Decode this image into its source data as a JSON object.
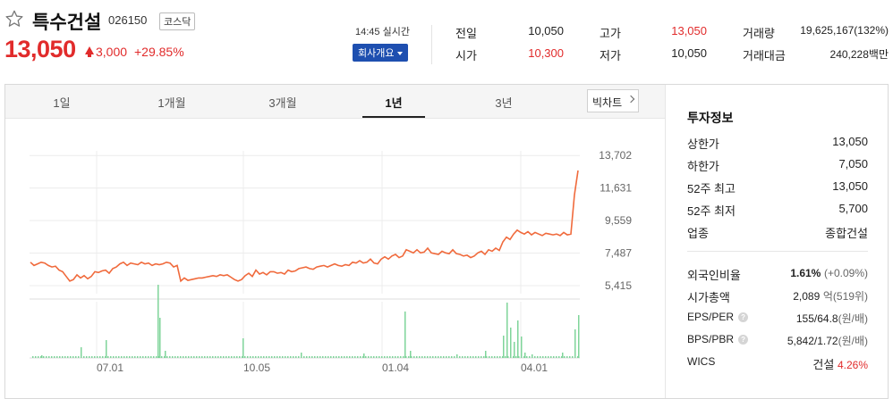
{
  "stock": {
    "name": "특수건설",
    "code": "026150",
    "market": "코스닥",
    "price": "13,050",
    "change": "3,000",
    "change_pct": "+29.85%",
    "realtime": "14:45 실시간",
    "company_button": "회사개요"
  },
  "quotes": {
    "prev_close_label": "전일",
    "prev_close": "10,050",
    "open_label": "시가",
    "open": "10,300",
    "high_label": "고가",
    "high": "13,050",
    "low_label": "저가",
    "low": "10,050",
    "volume_label": "거래량",
    "volume": "19,625,167(132%)",
    "amount_label": "거래대금",
    "amount": "240,228백만"
  },
  "tabs": [
    "1일",
    "1개월",
    "3개월",
    "1년",
    "3년"
  ],
  "active_tab": "1년",
  "big_chart_label": "빅차트",
  "investment": {
    "title": "투자정보",
    "rows": [
      {
        "label": "상한가",
        "value": "13,050"
      },
      {
        "label": "하한가",
        "value": "7,050"
      },
      {
        "label": "52주 최고",
        "value": "13,050"
      },
      {
        "label": "52주 최저",
        "value": "5,700"
      },
      {
        "label": "업종",
        "value": "종합건설"
      }
    ],
    "rows2": [
      {
        "label": "외국인비율",
        "value": "1.61%",
        "extra": "(+0.09%)"
      },
      {
        "label": "시가총액",
        "value": "2,089",
        "extra": "억(519위)"
      },
      {
        "label": "EPS/PER",
        "value": "155/64.8",
        "extra": "(원/배)"
      },
      {
        "label": "BPS/PBR",
        "value": "5,842/1.72",
        "extra": "(원/배)"
      },
      {
        "label": "WICS",
        "value": "건설",
        "extra": "4.26%"
      }
    ]
  },
  "colors": {
    "up": "#e12b2b",
    "down": "#1a5bc9",
    "line": "#f06a3c",
    "volume": "#7fd49a",
    "button": "#1e4fb0"
  },
  "chart_data": {
    "type": "line",
    "y_ticks": [
      "13,702",
      "11,631",
      "9,559",
      "7,487",
      "5,415"
    ],
    "x_ticks": [
      "07.01",
      "10.05",
      "01.04",
      "04.01"
    ],
    "ylim": [
      4900,
      14000
    ],
    "price": [
      6900,
      6700,
      6800,
      6900,
      6850,
      6700,
      6600,
      6650,
      6400,
      6300,
      6000,
      5700,
      5800,
      6100,
      5900,
      6050,
      5850,
      6000,
      6300,
      6250,
      6350,
      6400,
      6200,
      6500,
      6600,
      6800,
      6900,
      6700,
      6850,
      6800,
      6750,
      6900,
      6800,
      6850,
      6700,
      6800,
      6750,
      6800,
      6900,
      6850,
      6600,
      6700,
      5700,
      5900,
      5750,
      5800,
      5850,
      5900,
      5900,
      5950,
      6000,
      6050,
      6000,
      6100,
      6050,
      6100,
      5950,
      5800,
      5700,
      5800,
      6050,
      6200,
      6000,
      6400,
      6150,
      6250,
      6100,
      6300,
      6300,
      6200,
      6250,
      6150,
      6400,
      6300,
      6350,
      6500,
      6550,
      6600,
      6500,
      6450,
      6600,
      6650,
      6700,
      6600,
      6700,
      6800,
      6700,
      6650,
      6750,
      6700,
      6900,
      6850,
      7000,
      6850,
      6900,
      7100,
      6850,
      6800,
      7100,
      7250,
      7100,
      7300,
      7400,
      7200,
      7300,
      7700,
      7600,
      7500,
      7700,
      7500,
      7550,
      7800,
      7500,
      7450,
      7400,
      7600,
      7500,
      7450,
      7700,
      7450,
      7400,
      7300,
      7350,
      7200,
      7300,
      7500,
      7600,
      7400,
      7700,
      7600,
      7800,
      7650,
      8200,
      8500,
      8350,
      8700,
      8950,
      8800,
      8700,
      8850,
      8650,
      8800,
      8700,
      8600,
      8750,
      8700,
      8650,
      8700,
      8600,
      8800,
      8650,
      8700,
      11200,
      12750
    ]
  }
}
